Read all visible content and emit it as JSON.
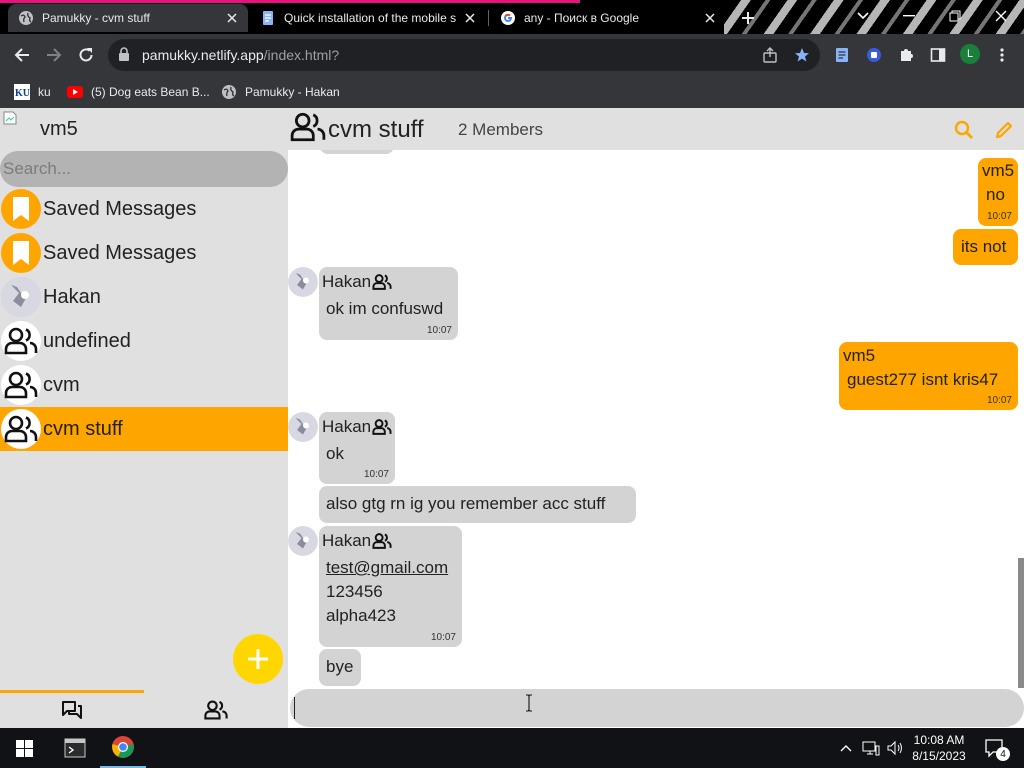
{
  "browser": {
    "tabs": [
      {
        "title": "Pamukky - cvm stuff",
        "favicon": "globe-icon",
        "active": true
      },
      {
        "title": "Quick installation of the mobile s",
        "favicon": "docs-icon",
        "active": false
      },
      {
        "title": "any - Поиск в Google",
        "favicon": "google-icon",
        "active": false
      }
    ],
    "url_domain": "pamukky.netlify.app",
    "url_path": "/index.html?",
    "profile_initial": "L",
    "bookmarks": [
      {
        "label": "ku",
        "icon": "ku-icon"
      },
      {
        "label": "(5) Dog eats Bean B...",
        "icon": "youtube-icon"
      },
      {
        "label": "Pamukky - Hakan",
        "icon": "globe-icon"
      }
    ]
  },
  "app": {
    "current_user": "vm5",
    "search_placeholder": "Search...",
    "chats": [
      {
        "name": "Saved Messages",
        "avatar": "bookmark-icon",
        "selected": false
      },
      {
        "name": "Saved Messages",
        "avatar": "bookmark-icon",
        "selected": false
      },
      {
        "name": "Hakan",
        "avatar": "user-avatar",
        "selected": false
      },
      {
        "name": "undefined",
        "avatar": "group-icon",
        "selected": false
      },
      {
        "name": "cvm",
        "avatar": "group-icon",
        "selected": false
      },
      {
        "name": "cvm stuff",
        "avatar": "group-icon",
        "selected": true
      }
    ],
    "chat_header": {
      "title": "cvm stuff",
      "members": "2 Members"
    },
    "messages": [
      {
        "direction": "out",
        "sender": "vm5",
        "lines": [
          "no"
        ],
        "time": "10:07"
      },
      {
        "direction": "out",
        "lines": [
          "its not"
        ]
      },
      {
        "direction": "in",
        "sender": "Hakan",
        "lines": [
          "ok im confuswd"
        ],
        "time": "10:07"
      },
      {
        "direction": "out",
        "sender": "vm5",
        "lines": [
          "guest277 isnt kris47"
        ],
        "time": "10:07"
      },
      {
        "direction": "in",
        "sender": "Hakan",
        "lines": [
          "ok"
        ],
        "time": "10:07"
      },
      {
        "direction": "in",
        "lines": [
          "also gtg rn ig you remember acc stuff"
        ]
      },
      {
        "direction": "in",
        "sender": "Hakan",
        "lines": [
          "test@gmail.com",
          "123456",
          "alpha423"
        ],
        "time": "10:07"
      },
      {
        "direction": "in",
        "lines": [
          "bye"
        ]
      }
    ],
    "composer_value": "",
    "colors": {
      "accent": "#ffa500",
      "fab": "#ffd600",
      "incoming": "#d3d3d3",
      "sidebar": "#e0e0e0"
    }
  },
  "taskbar": {
    "time": "10:08 AM",
    "date": "8/15/2023",
    "notifications": "4"
  }
}
